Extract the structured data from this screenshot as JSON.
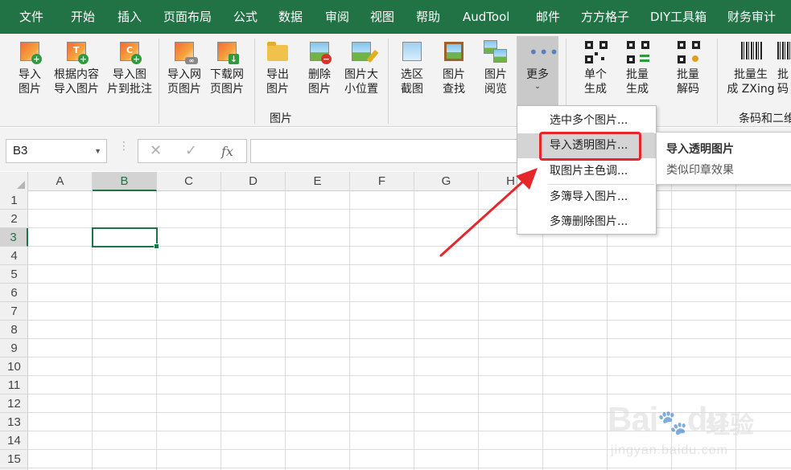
{
  "menu": {
    "tabs": [
      "文件",
      "开始",
      "插入",
      "页面布局",
      "公式",
      "数据",
      "审阅",
      "视图",
      "帮助",
      "AudTool",
      "邮件",
      "方方格子",
      "DIY工具箱",
      "财务审计"
    ]
  },
  "ribbon": {
    "picture_group_label": "图片",
    "barcode_group_label": "条码和二维",
    "buttons": {
      "import_picture": "导入\n图片",
      "import_by_content": "根据内容\n导入图片",
      "import_to_comment": "导入图\n片到批注",
      "import_web": "导入网\n页图片",
      "download_web": "下载网\n页图片",
      "export_picture": "导出\n图片",
      "delete_picture": "删除\n图片",
      "picture_size_position": "图片大\n小位置",
      "select_area_screenshot": "选区\n截图",
      "picture_find": "图片\n查找",
      "picture_browse": "图片\n阅览",
      "more": "更多",
      "single_generate": "单个\n生成",
      "batch_generate": "批量\n生成",
      "batch_decode": "批量\n解码",
      "batch_zxing": "批量生\n成 ZXing",
      "cut_edge": "批\n码"
    }
  },
  "formula_bar": {
    "name_box": "B3",
    "cancel_symbol": "✕",
    "confirm_symbol": "✓",
    "fx_symbol": "fx",
    "formula": ""
  },
  "grid": {
    "columns": [
      "A",
      "B",
      "C",
      "D",
      "E",
      "F",
      "G",
      "H",
      "I",
      "J",
      "K",
      "L"
    ],
    "rows": [
      "1",
      "2",
      "3",
      "4",
      "5",
      "6",
      "7",
      "8",
      "9",
      "10",
      "11",
      "12",
      "13",
      "14",
      "15"
    ],
    "selected_column": "B",
    "selected_row": "3"
  },
  "more_menu": {
    "items": [
      "选中多个图片...",
      "导入透明图片...",
      "取图片主色调...",
      "多簿导入图片...",
      "多簿删除图片..."
    ],
    "highlighted_index": 1
  },
  "tooltip": {
    "title": "导入透明图片",
    "description": "类似印章效果"
  },
  "colors": {
    "excel_green": "#217346",
    "highlight_red": "#e5262a",
    "ribbon_bg": "#f3f3f3"
  },
  "watermark": {
    "brand": "Bai",
    "brand_suffix": "du",
    "cn": "经验",
    "url": "jingyan.baidu.com"
  }
}
